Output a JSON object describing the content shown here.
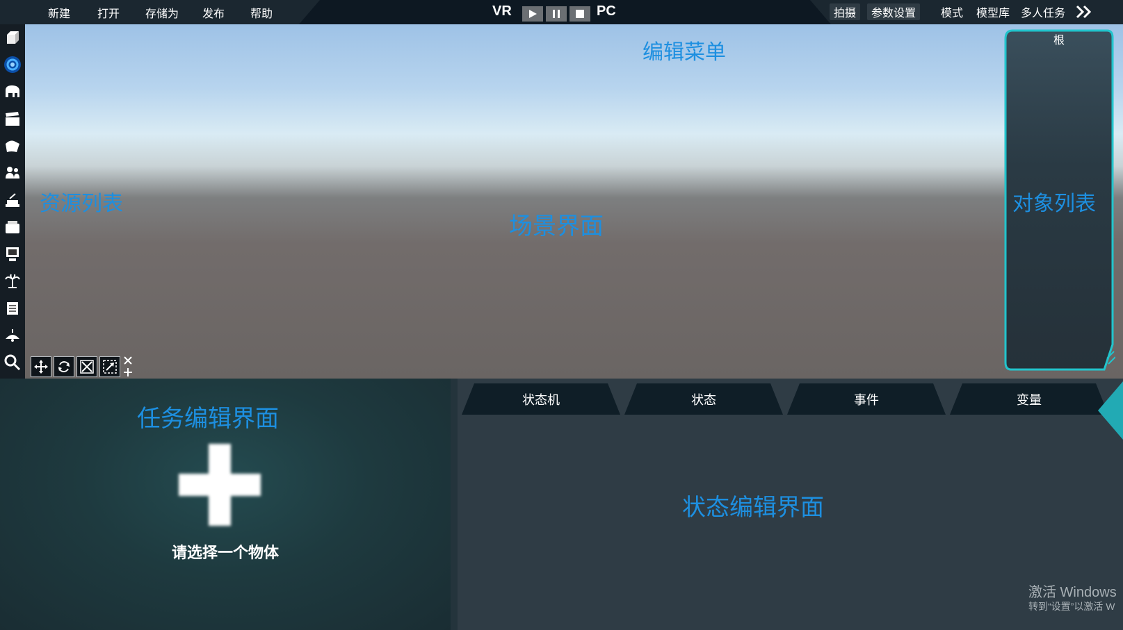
{
  "menu": [
    "新建",
    "打开",
    "存储为",
    "发布",
    "帮助"
  ],
  "playbar": {
    "vr": "VR",
    "pc": "PC"
  },
  "right_menu": {
    "capture": "拍摄",
    "params": "参数设置",
    "mode": "模式",
    "model_lib": "模型库",
    "multi_task": "多人任务"
  },
  "annotations": {
    "edit_menu": "编辑菜单",
    "resource_list": "资源列表",
    "scene_view": "场景界面",
    "object_list": "对象列表",
    "task_editor": "任务编辑界面",
    "state_editor": "状态编辑界面"
  },
  "object_panel": {
    "root": "根"
  },
  "task_panel": {
    "hint": "请选择一个物体"
  },
  "state_tabs": [
    "状态机",
    "状态",
    "事件",
    "变量"
  ],
  "watermark": {
    "line1": "激活 Windows",
    "line2": "转到“设置”以激活 W"
  },
  "colors": {
    "annotation": "#1d8fe0",
    "accent_teal": "#22c4cc",
    "menu_bg": "#1b2730"
  },
  "tools": [
    "cube-icon",
    "globe-icon",
    "elephant-icon",
    "clapper-icon",
    "cloth-icon",
    "people-icon",
    "desk-lamp-icon",
    "printer-icon",
    "monitor-icon",
    "palm-tree-icon",
    "book-icon",
    "ceiling-lamp-icon",
    "search-icon"
  ]
}
